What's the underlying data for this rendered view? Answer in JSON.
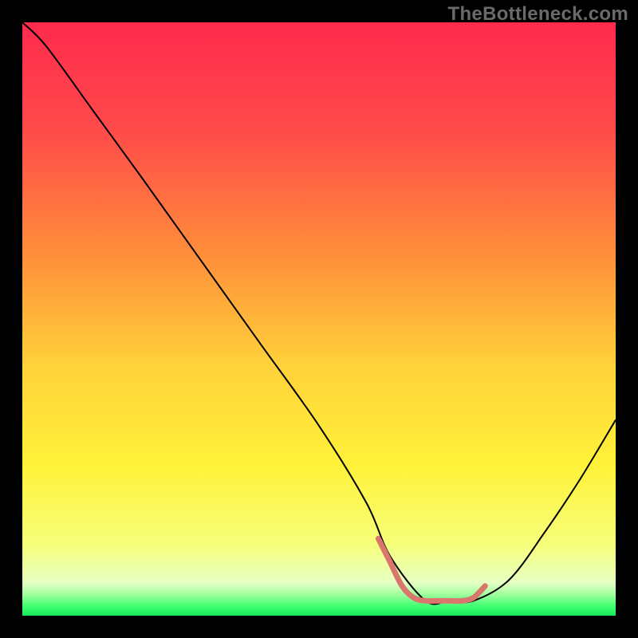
{
  "attribution": "TheBottleneck.com",
  "chart_data": {
    "type": "line",
    "title": "",
    "xlabel": "",
    "ylabel": "",
    "xlim": [
      0,
      100
    ],
    "ylim": [
      0,
      100
    ],
    "series": [
      {
        "name": "curve",
        "color": "#000000",
        "stroke_width": 2,
        "x": [
          0,
          4,
          12,
          20,
          30,
          40,
          50,
          58,
          62,
          68,
          72,
          76,
          82,
          88,
          94,
          100
        ],
        "values": [
          100,
          96,
          85,
          74,
          60,
          46,
          32,
          19,
          10,
          2.5,
          2.5,
          2.5,
          6,
          14,
          23,
          33
        ]
      },
      {
        "name": "highlight-segment",
        "color": "#d9776e",
        "stroke_width": 7,
        "x": [
          60,
          62,
          64,
          66,
          68,
          70,
          72,
          74,
          76,
          78
        ],
        "values": [
          13,
          9,
          5,
          3,
          2.5,
          2.5,
          2.5,
          2.5,
          3,
          5
        ]
      }
    ],
    "background_gradient": {
      "stops": [
        {
          "offset": 0.0,
          "color": "#ff2a4d"
        },
        {
          "offset": 0.18,
          "color": "#ff4a4a"
        },
        {
          "offset": 0.38,
          "color": "#ff8a3a"
        },
        {
          "offset": 0.58,
          "color": "#ffd23a"
        },
        {
          "offset": 0.75,
          "color": "#fff23a"
        },
        {
          "offset": 0.88,
          "color": "#f6ff7a"
        },
        {
          "offset": 0.945,
          "color": "#e6ffc4"
        },
        {
          "offset": 0.965,
          "color": "#9cff9c"
        },
        {
          "offset": 0.985,
          "color": "#3cff6e"
        },
        {
          "offset": 1.0,
          "color": "#18e858"
        }
      ]
    }
  }
}
